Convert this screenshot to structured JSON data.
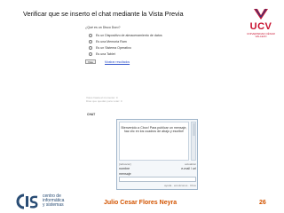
{
  "slide": {
    "title": "Verificar que se inserto el chat mediante la Vista Previa"
  },
  "logo": {
    "name": "UCV",
    "subtitle": "UNIVERSIDAD CÉSAR VALLEJO"
  },
  "poll": {
    "question": "¿Qué es un Disco Duro?",
    "options": [
      "Es un Dispositivo de almacenamiento de datos",
      "Es una Memoria Ram",
      "Es un Sistema Operativo",
      "Es una Tablet"
    ],
    "vote_label": "Vote",
    "results_label": "Mostrar resultados",
    "stats": [
      "Votos hasta el momento: 0",
      "Días que quedan para votar: 0"
    ]
  },
  "chat": {
    "label": "CHAT",
    "welcome": "Bienvenido a Cbox! Para publicar un mensaje, haz clic en los cuadros de abajo y escribe!",
    "status_left": "[refrescar]",
    "status_right": "actualizar",
    "name_label": "nombre",
    "url_label": "e-mail / url",
    "message_label": "mensaje",
    "links": "ayuda · emoticonos · Cbox"
  },
  "footer": {
    "org_line1": "centro de",
    "org_line2": "informática",
    "org_line3": "y sistemas",
    "author": "Julio Cesar Flores Neyra",
    "page": "26"
  },
  "colors": {
    "brand_red": "#c8102e",
    "footer_orange": "#d35400",
    "cis_blue": "#2a4d75",
    "link_blue": "#3355cc"
  }
}
